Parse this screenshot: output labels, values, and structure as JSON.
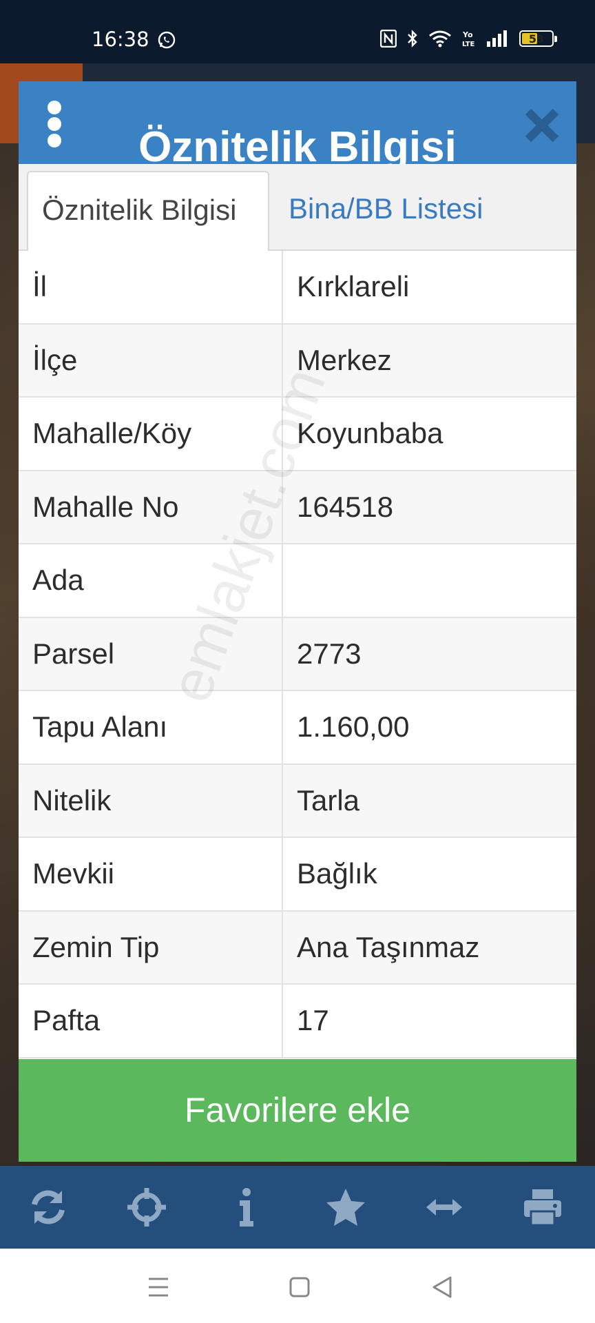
{
  "status_bar": {
    "time": "16:38",
    "battery": "53",
    "battery_level_percent": 53,
    "icons": [
      "whatsapp-icon",
      "nfc-icon",
      "bluetooth-icon",
      "wifi-icon",
      "volte-icon",
      "signal-icon",
      "battery-icon"
    ]
  },
  "dialog": {
    "title": "Öznitelik Bilgisi",
    "tabs": [
      {
        "label": "Öznitelik Bilgisi",
        "active": true
      },
      {
        "label": "Bina/BB Listesi",
        "active": false
      }
    ],
    "rows": [
      {
        "key": "İl",
        "value": "Kırklareli"
      },
      {
        "key": "İlçe",
        "value": "Merkez"
      },
      {
        "key": "Mahalle/Köy",
        "value": "Koyunbaba"
      },
      {
        "key": "Mahalle No",
        "value": "164518"
      },
      {
        "key": "Ada",
        "value": ""
      },
      {
        "key": "Parsel",
        "value": "2773"
      },
      {
        "key": "Tapu Alanı",
        "value": "1.160,00"
      },
      {
        "key": "Nitelik",
        "value": "Tarla"
      },
      {
        "key": "Mevkii",
        "value": "Bağlık"
      },
      {
        "key": "Zemin Tip",
        "value": "Ana Taşınmaz"
      },
      {
        "key": "Pafta",
        "value": "17"
      }
    ],
    "favorite_button": "Favorilere ekle"
  },
  "watermark": "emlakjet.com",
  "toolbar": {
    "icons": [
      "refresh-icon",
      "crosshair-icon",
      "info-icon",
      "star-icon",
      "measure-icon",
      "print-icon"
    ]
  },
  "colors": {
    "header_blue": "#3a82c4",
    "tab_link_blue": "#3a7bbf",
    "favorite_green": "#5cb85c",
    "toolbar_blue": "#244f7d",
    "toolbar_icon": "#8fa8c4"
  }
}
